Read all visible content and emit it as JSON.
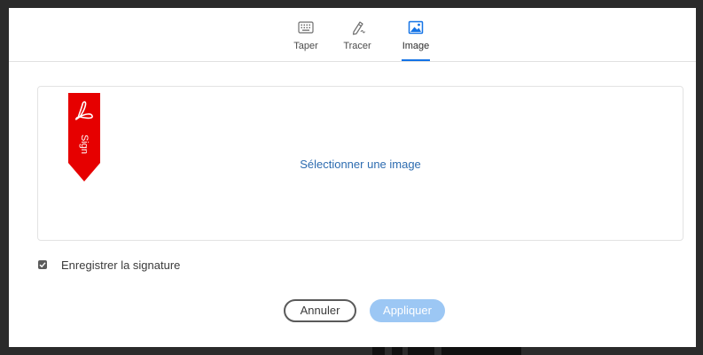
{
  "tabs": [
    {
      "label": "Taper",
      "icon": "keyboard-icon",
      "active": false
    },
    {
      "label": "Tracer",
      "icon": "pen-draw-icon",
      "active": false
    },
    {
      "label": "Image",
      "icon": "image-icon",
      "active": true
    }
  ],
  "dropzone": {
    "select_label": "Sélectionner une image",
    "ribbon_text": "Sign"
  },
  "save_signature": {
    "label": "Enregistrer la signature",
    "checked": true
  },
  "buttons": {
    "cancel": "Annuler",
    "apply": "Appliquer"
  },
  "colors": {
    "accent": "#1473e6",
    "link": "#2d6cb0",
    "ribbon": "#e60000",
    "apply_disabled": "#9cc7f4"
  }
}
